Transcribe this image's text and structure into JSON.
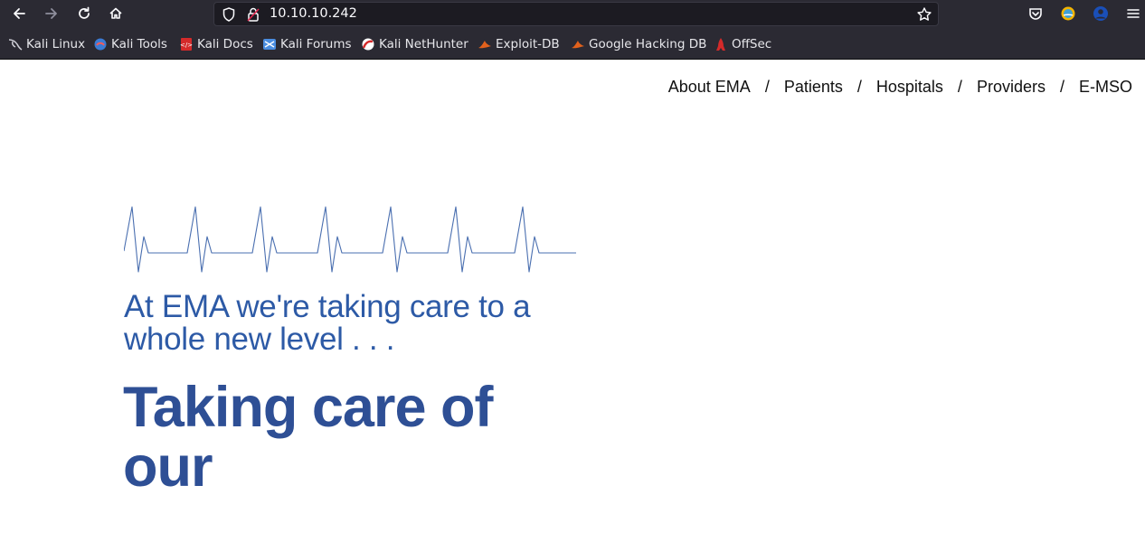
{
  "browser": {
    "url": "10.10.10.242",
    "bookmarks": [
      {
        "label": "Kali Linux",
        "icon": "kali-dragon-icon"
      },
      {
        "label": "Kali Tools",
        "icon": "kali-tools-icon"
      },
      {
        "label": "Kali Docs",
        "icon": "kali-docs-icon"
      },
      {
        "label": "Kali Forums",
        "icon": "kali-forums-icon"
      },
      {
        "label": "Kali NetHunter",
        "icon": "kali-nethunter-icon"
      },
      {
        "label": "Exploit-DB",
        "icon": "exploit-db-icon"
      },
      {
        "label": "Google Hacking DB",
        "icon": "ghdb-icon"
      },
      {
        "label": "OffSec",
        "icon": "offsec-icon"
      }
    ]
  },
  "nav": {
    "items": [
      "About EMA",
      "Patients",
      "Hospitals",
      "Providers",
      "E-MSO"
    ],
    "separator": "/"
  },
  "hero": {
    "tagline": "At EMA we're taking care to a whole new level . . .",
    "headline": "Taking care of our"
  },
  "colors": {
    "accent": "#2d5aa6",
    "headline": "#2e4f95",
    "ekg_line": "#4a6fb0"
  }
}
